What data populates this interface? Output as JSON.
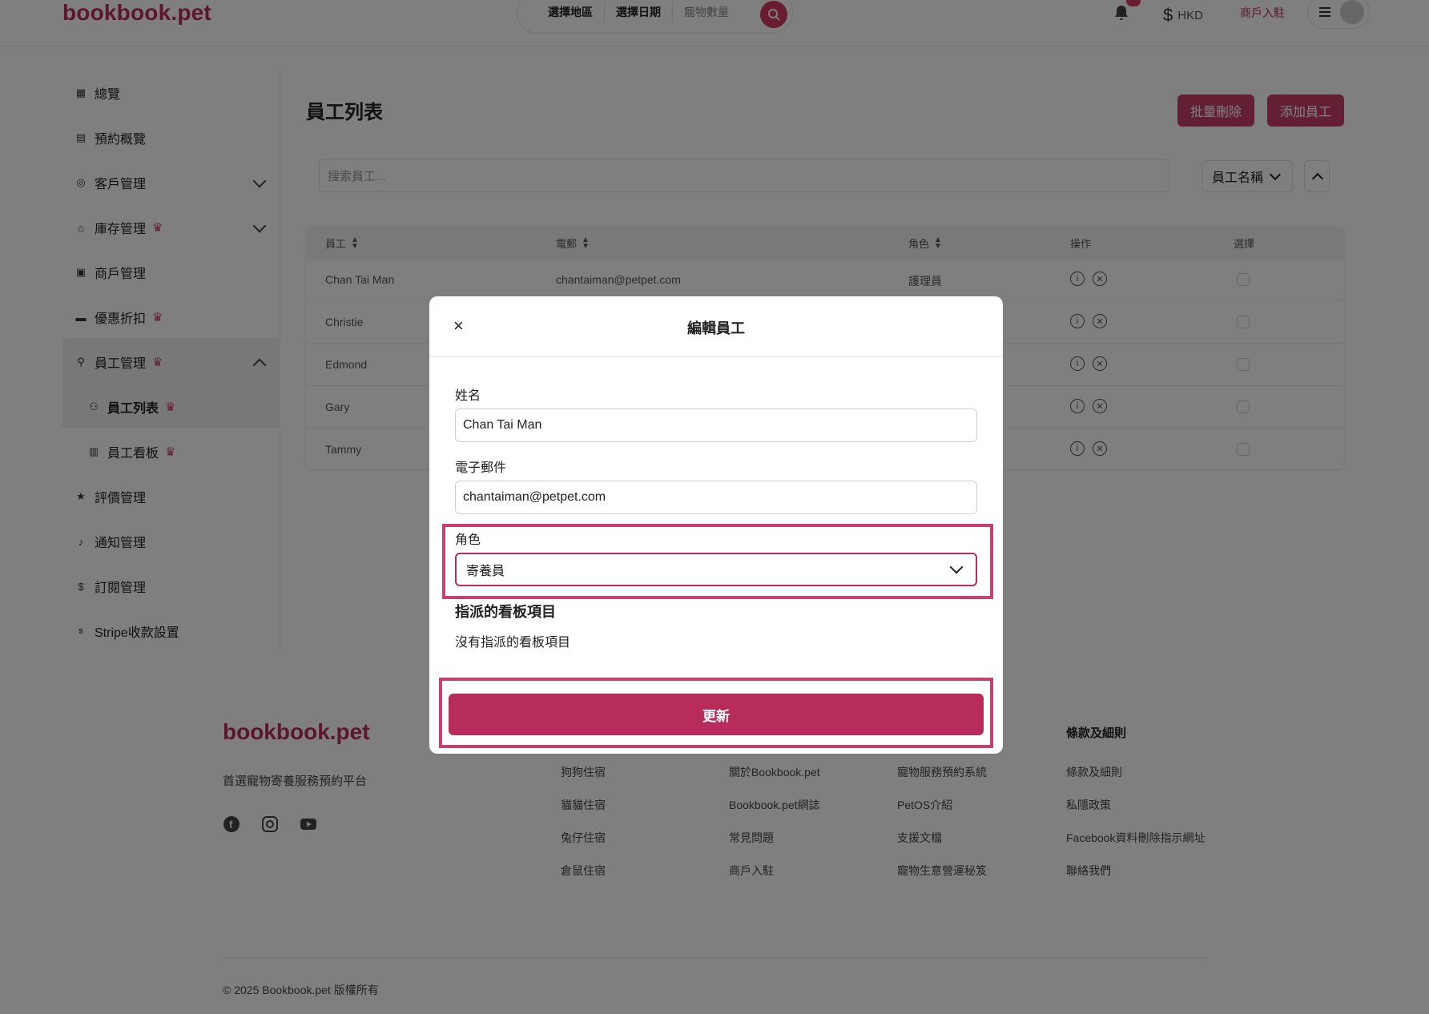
{
  "header": {
    "logo": "bookbook.pet",
    "search": {
      "region": "選擇地區",
      "date": "選擇日期",
      "pets": "寵物數量"
    },
    "currency": "HKD",
    "merchant_link": "商戶入駐"
  },
  "sidebar": {
    "items": [
      {
        "label": "總覽"
      },
      {
        "label": "預約概覽"
      },
      {
        "label": "客戶管理"
      },
      {
        "label": "庫存管理"
      },
      {
        "label": "商戶管理"
      },
      {
        "label": "優惠折扣"
      },
      {
        "label": "員工管理"
      },
      {
        "label": "員工列表"
      },
      {
        "label": "員工看板"
      },
      {
        "label": "評價管理"
      },
      {
        "label": "通知管理"
      },
      {
        "label": "訂閱管理"
      },
      {
        "label": "Stripe收款設置"
      }
    ]
  },
  "main": {
    "title": "員工列表",
    "bulk_delete": "批量刪除",
    "add_staff": "添加員工",
    "search_placeholder": "搜索員工...",
    "sort_by": "員工名稱",
    "table": {
      "headers": [
        "員工",
        "電郵",
        "角色",
        "操作",
        "選擇"
      ],
      "rows": [
        {
          "name": "Chan Tai Man",
          "email": "chantaiman@petpet.com",
          "role": "護理員"
        },
        {
          "name": "Christie"
        },
        {
          "name": "Edmond"
        },
        {
          "name": "Gary"
        },
        {
          "name": "Tammy"
        }
      ]
    }
  },
  "footer": {
    "logo": "bookbook.pet",
    "tagline": "首選寵物寄養服務預約平台",
    "col1": [
      "狗狗住宿",
      "貓貓住宿",
      "兔仔住宿",
      "倉鼠住宿"
    ],
    "col2": [
      "關於Bookbook.pet",
      "Bookbook.pet網誌",
      "常見問題",
      "商戶入駐"
    ],
    "col3": [
      "寵物服務預約系統",
      "PetOS介紹",
      "支援文檔",
      "寵物生意營運秘笈"
    ],
    "col4_title": "條款及細則",
    "col4": [
      "條款及細則",
      "私隱政策",
      "Facebook資料刪除指示網址",
      "聯絡我們"
    ],
    "copyright": "© 2025 Bookbook.pet 版權所有"
  },
  "modal": {
    "title": "編輯員工",
    "close": "×",
    "name_label": "姓名",
    "name_value": "Chan Tai Man",
    "email_label": "電子郵件",
    "email_value": "chantaiman@petpet.com",
    "role_label": "角色",
    "role_value": "寄養員",
    "assigned_title": "指派的看板項目",
    "assigned_empty": "沒有指派的看板項目",
    "update_button": "更新"
  },
  "colors": {
    "brand": "#b82c5c",
    "accent": "#c6416b"
  }
}
